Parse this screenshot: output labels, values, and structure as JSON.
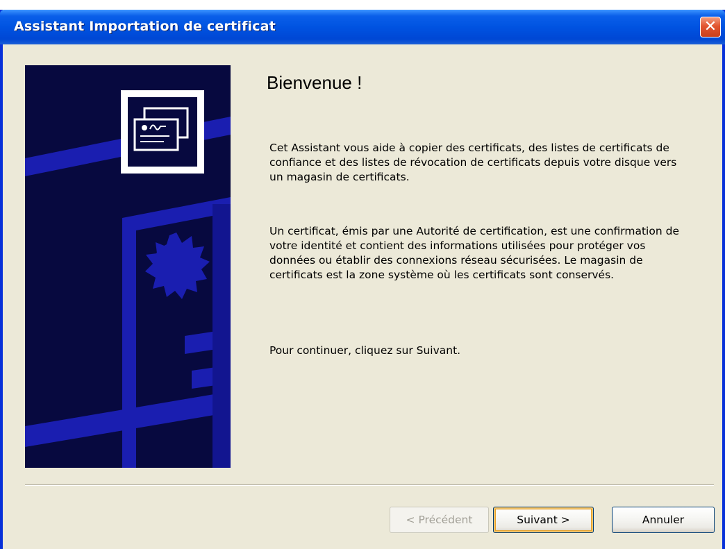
{
  "window": {
    "title": "Assistant Importation de certificat",
    "close_glyph": "✕"
  },
  "content": {
    "heading": "Bienvenue !",
    "paragraph1": "Cet Assistant vous aide à copier des certificats, des listes de certificats de confiance et des listes de révocation de certificats depuis votre disque vers un magasin de certificats.",
    "paragraph2": "Un certificat, émis par une Autorité de certification, est une confirmation de votre identité et contient des informations utilisées pour protéger vos données ou établir des connexions réseau sécurisées. Le magasin de certificats est la zone système où les certificats sont conservés.",
    "paragraph3": "Pour continuer, cliquez sur Suivant."
  },
  "buttons": {
    "back": {
      "label": "< Précédent",
      "enabled": false
    },
    "next": {
      "label": "Suivant >",
      "enabled": true,
      "default": true
    },
    "cancel": {
      "label": "Annuler",
      "enabled": true
    }
  },
  "icons": {
    "side_panel": "certificate-wizard-illustration",
    "close": "close-icon"
  },
  "colors": {
    "titlebar": "#0053e1",
    "window_face": "#ece9d8",
    "side_panel_bg": "#07093f",
    "side_panel_accent": "#1a1eb0",
    "close_button": "#e2542f",
    "default_button_highlight": "#e5a12a"
  }
}
